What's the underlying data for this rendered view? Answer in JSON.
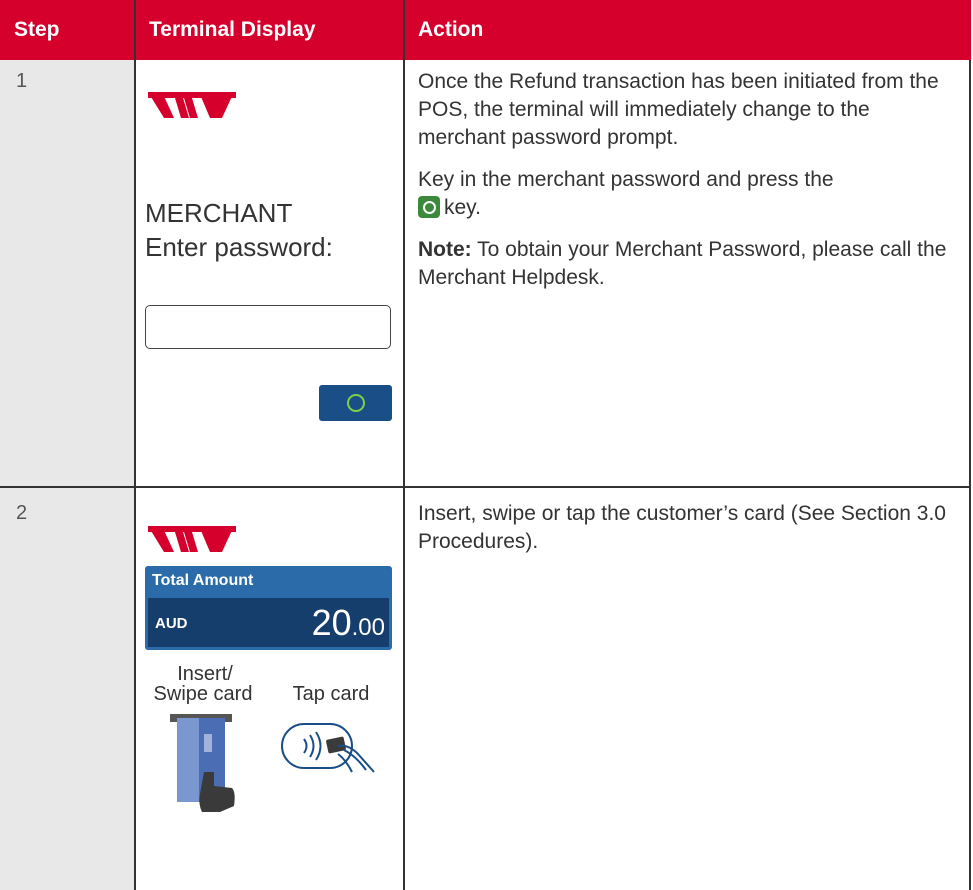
{
  "header": {
    "step": "Step",
    "display": "Terminal Display",
    "action": "Action"
  },
  "rows": [
    {
      "step": "1",
      "prompt_line1": "MERCHANT",
      "prompt_line2": "Enter password:",
      "action": {
        "p1": "Once the Refund transaction has been initiated from the POS, the terminal will immediately change to the merchant password prompt.",
        "p2_before": "Key in the merchant password and press the",
        "p2_after": "key.",
        "note_label": "Note:",
        "note_text": " To obtain your Merchant Password, please call the Merchant Helpdesk."
      }
    },
    {
      "step": "2",
      "amount_label": "Total Amount",
      "currency": "AUD",
      "amount_main": "20",
      "amount_decimal": ".00",
      "insert_label_1": "Insert/",
      "insert_label_2": "Swipe card",
      "tap_label": "Tap card",
      "action": {
        "p1": "Insert, swipe or tap the customer’s card (See Section 3.0 Procedures)."
      }
    }
  ],
  "colors": {
    "header_bg": "#d5002b",
    "step_bg": "#e8e8e8",
    "ok_button": "#1a4e86",
    "amount_panel": "#2b6ba9",
    "ok_key": "#3b8a3b"
  },
  "icons": [
    "westpac-logo-icon",
    "ok-key-icon",
    "ok-circle-icon",
    "insert-swipe-card-icon",
    "contactless-tap-icon"
  ]
}
